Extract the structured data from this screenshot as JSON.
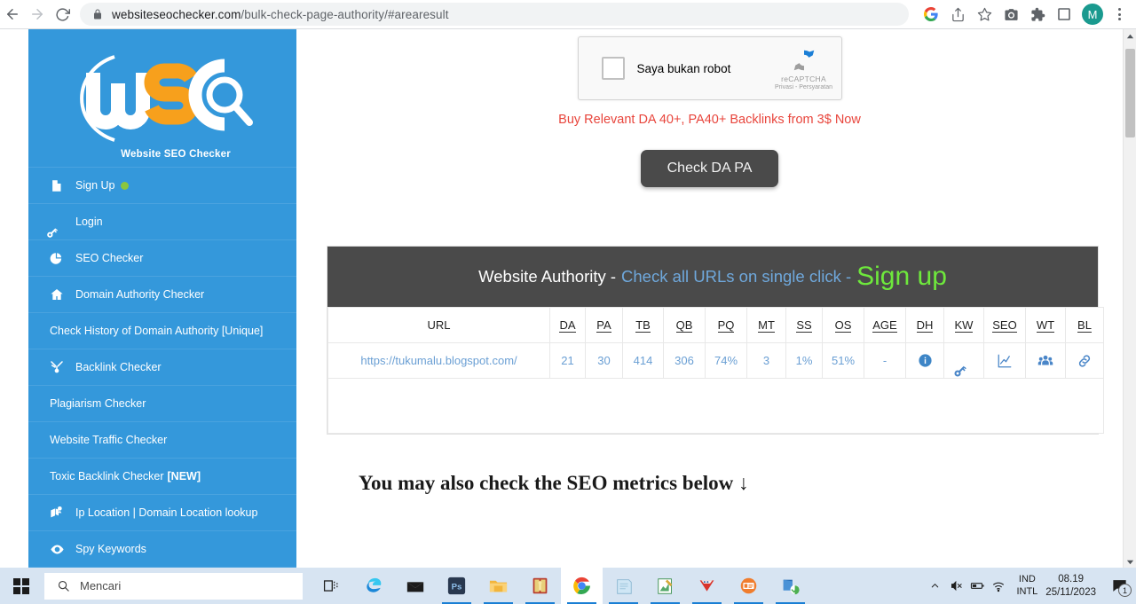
{
  "browser": {
    "url_domain": "websiteseochecker.com",
    "url_path": "/bulk-check-page-authority/#arearesult",
    "back_label": "Back",
    "forward_label": "Forward",
    "reload_label": "Reload",
    "profile_initial": "M"
  },
  "sidebar": {
    "logo_text": "WSC",
    "logo_subtitle": "Website SEO Checker",
    "items": [
      {
        "label": "Sign Up",
        "icon": "signup-document-icon",
        "dot": true
      },
      {
        "label": "Login",
        "icon": "key-icon"
      },
      {
        "label": "SEO Checker",
        "icon": "pie-chart-icon"
      },
      {
        "label": "Domain Authority Checker",
        "icon": "home-icon"
      },
      {
        "label": "Check History of Domain Authority [Unique]",
        "icon": ""
      },
      {
        "label": "Backlink Checker",
        "icon": "backlink-icon"
      },
      {
        "label": "Plagiarism Checker",
        "icon": ""
      },
      {
        "label": "Website Traffic Checker",
        "icon": ""
      },
      {
        "label": "Toxic Backlink Checker ",
        "badge": "[NEW]",
        "icon": ""
      },
      {
        "label": "Ip Location | Domain Location lookup",
        "icon": "map-pin-icon"
      },
      {
        "label": "Spy Keywords",
        "icon": "eye-icon"
      }
    ]
  },
  "captcha": {
    "label": "Saya bukan robot",
    "brand": "reCAPTCHA",
    "terms": "Privasi - Persyaratan"
  },
  "promo": {
    "text": "Buy Relevant DA 40+, PA40+ Backlinks from 3$ Now"
  },
  "cta": {
    "label": "Check DA PA"
  },
  "results": {
    "banner": {
      "title": "Website Authority -",
      "subtitle": "Check all URLs on single click -",
      "signup": "Sign up"
    },
    "columns": [
      "URL",
      "DA",
      "PA",
      "TB",
      "QB",
      "PQ",
      "MT",
      "SS",
      "OS",
      "AGE",
      "DH",
      "KW",
      "SEO",
      "WT",
      "BL"
    ],
    "rows": [
      {
        "url": "https://tukumalu.blogspot.com/",
        "da": "21",
        "pa": "30",
        "tb": "414",
        "qb": "306",
        "pq": "74%",
        "mt": "3",
        "ss": "1%",
        "os": "51%",
        "age": "-",
        "dh_icon": "info-icon",
        "kw_icon": "key-icon",
        "seo_icon": "line-chart-icon",
        "wt_icon": "people-group-icon",
        "bl_icon": "link-chain-icon"
      }
    ]
  },
  "below": {
    "heading": "You may also check the SEO metrics below ↓"
  },
  "taskbar": {
    "search_placeholder": "Mencari",
    "apps": [
      "task-view-icon",
      "edge-icon",
      "mail-icon",
      "photoshop-icon",
      "file-explorer-icon",
      "winrar-icon",
      "chrome-icon",
      "notepad-icon",
      "editor-icon",
      "red-app-icon",
      "orange-app-icon",
      "blue-green-app-icon"
    ],
    "lang_line1": "IND",
    "lang_line2": "INTL",
    "time": "08.19",
    "date": "25/11/2023",
    "notification_count": "1"
  },
  "colors": {
    "sidebar_blue": "#3498db",
    "accent_red": "#e8453c",
    "link_blue": "#6a9fd4",
    "signup_green": "#6ee83c",
    "banner_dark": "#4a4a4a"
  }
}
